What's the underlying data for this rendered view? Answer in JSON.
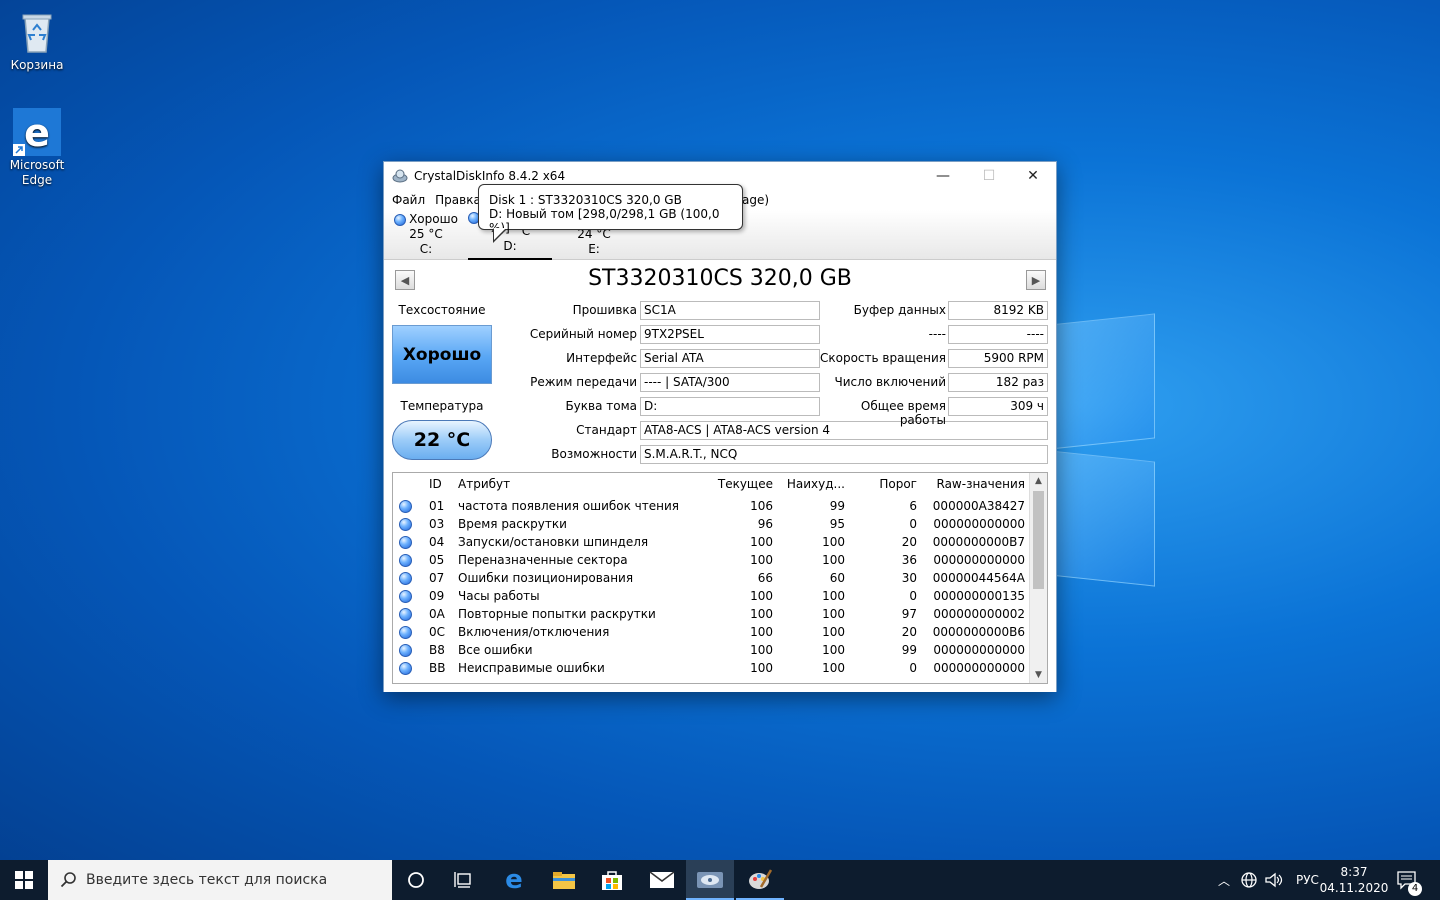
{
  "desktop": {
    "icons": [
      {
        "label": "Корзина"
      },
      {
        "label": "Microsoft Edge"
      }
    ]
  },
  "window": {
    "title": "CrystalDiskInfo 8.4.2 x64",
    "menu": [
      "Файл",
      "Правка",
      "age)"
    ],
    "disks": [
      {
        "status": "Хорошо",
        "temp": "25 °C",
        "letter": "C:"
      },
      {
        "status": "",
        "temp": "°C",
        "letter": "D:"
      },
      {
        "status": "",
        "temp": "24 °C",
        "letter": "E:"
      }
    ],
    "tooltip": {
      "line1": "Disk 1 : ST3320310CS 320,0 GB",
      "line2": "D: Новый том [298,0/298,1 GB (100,0 %)]"
    },
    "model": "ST3320310CS 320,0 GB",
    "health": {
      "label": "Техсостояние",
      "value": "Хорошо"
    },
    "temperature": {
      "label": "Температура",
      "value": "22 °C"
    },
    "fields": {
      "firmware": {
        "label": "Прошивка",
        "value": "SC1A"
      },
      "serial": {
        "label": "Серийный номер",
        "value": "9TX2PSEL"
      },
      "interface": {
        "label": "Интерфейс",
        "value": "Serial ATA"
      },
      "transfer": {
        "label": "Режим передачи",
        "value": "---- | SATA/300"
      },
      "drive_letter": {
        "label": "Буква тома",
        "value": "D:"
      },
      "standard": {
        "label": "Стандарт",
        "value": "ATA8-ACS | ATA8-ACS version 4"
      },
      "features": {
        "label": "Возможности",
        "value": "S.M.A.R.T., NCQ"
      },
      "buffer": {
        "label": "Буфер данных",
        "value": "8192 KB"
      },
      "blank": {
        "label": "----",
        "value": "----"
      },
      "rotation": {
        "label": "Скорость вращения",
        "value": "5900 RPM"
      },
      "power_count": {
        "label": "Число включений",
        "value": "182 раз"
      },
      "power_hours": {
        "label": "Общее время работы",
        "value": "309 ч"
      }
    },
    "table": {
      "headers": {
        "id": "ID",
        "attr": "Атрибут",
        "cur": "Текущее",
        "worst": "Наихуд...",
        "thr": "Порог",
        "raw": "Raw-значения"
      },
      "rows": [
        {
          "id": "01",
          "attr": "частота появления ошибок чтения",
          "cur": "106",
          "worst": "99",
          "thr": "6",
          "raw": "000000A38427"
        },
        {
          "id": "03",
          "attr": "Время раскрутки",
          "cur": "96",
          "worst": "95",
          "thr": "0",
          "raw": "000000000000"
        },
        {
          "id": "04",
          "attr": "Запуски/остановки шпинделя",
          "cur": "100",
          "worst": "100",
          "thr": "20",
          "raw": "0000000000B7"
        },
        {
          "id": "05",
          "attr": "Переназначенные сектора",
          "cur": "100",
          "worst": "100",
          "thr": "36",
          "raw": "000000000000"
        },
        {
          "id": "07",
          "attr": "Ошибки позиционирования",
          "cur": "66",
          "worst": "60",
          "thr": "30",
          "raw": "00000044564A"
        },
        {
          "id": "09",
          "attr": "Часы работы",
          "cur": "100",
          "worst": "100",
          "thr": "0",
          "raw": "000000000135"
        },
        {
          "id": "0A",
          "attr": "Повторные попытки раскрутки",
          "cur": "100",
          "worst": "100",
          "thr": "97",
          "raw": "000000000002"
        },
        {
          "id": "0C",
          "attr": "Включения/отключения",
          "cur": "100",
          "worst": "100",
          "thr": "20",
          "raw": "0000000000B6"
        },
        {
          "id": "B8",
          "attr": "Все ошибки",
          "cur": "100",
          "worst": "100",
          "thr": "99",
          "raw": "000000000000"
        },
        {
          "id": "BB",
          "attr": "Неисправимые ошибки",
          "cur": "100",
          "worst": "100",
          "thr": "0",
          "raw": "000000000000"
        }
      ]
    }
  },
  "taskbar": {
    "search_placeholder": "Введите здесь текст для поиска",
    "lang": "РУС",
    "time": "8:37",
    "date": "04.11.2020",
    "notifications": "4"
  }
}
